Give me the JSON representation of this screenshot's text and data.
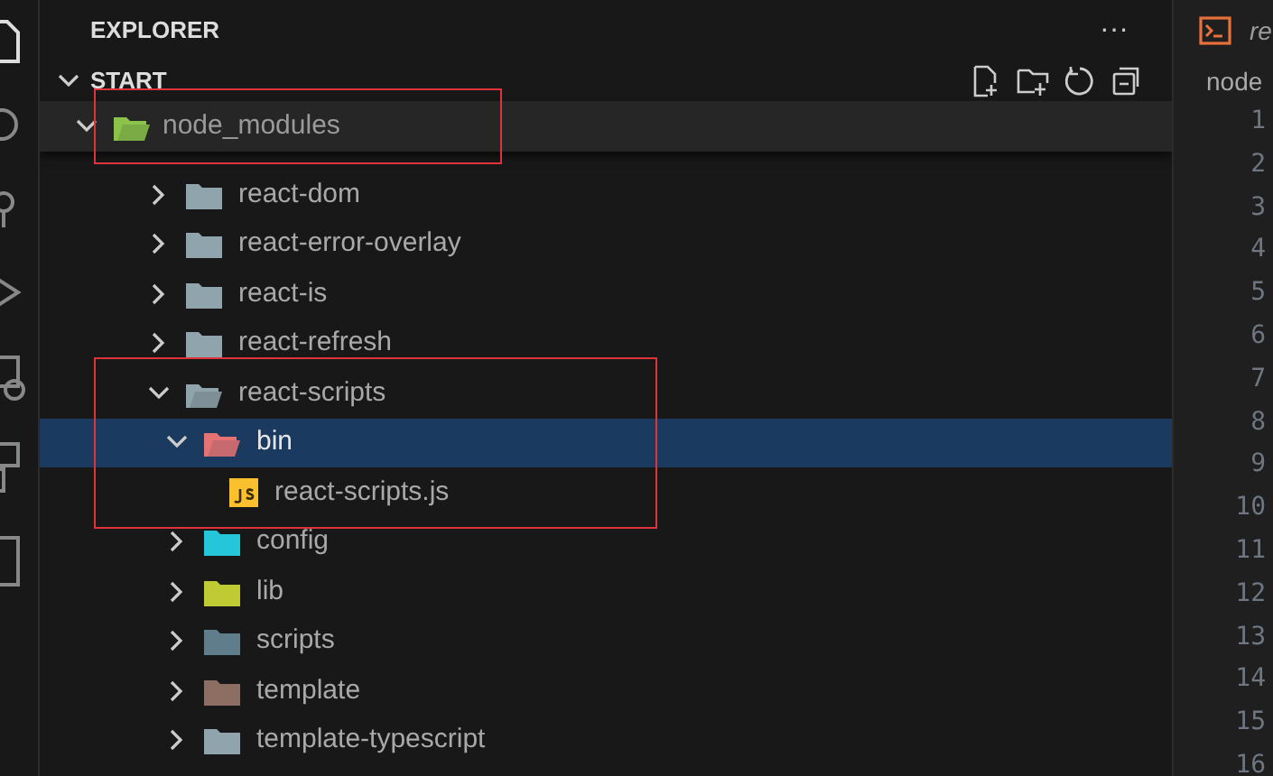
{
  "sidebar": {
    "title": "EXPLORER",
    "more": "···",
    "section": {
      "label": "START",
      "expanded": true
    },
    "sticky_header": {
      "label": "node_modules",
      "expanded": true,
      "color": "#8bc34a",
      "framed": true
    },
    "rows": [
      {
        "label": "react-dom",
        "kind": "folder",
        "expanded": false,
        "selected": false,
        "framed": false,
        "color": "#90a4ae"
      },
      {
        "label": "react-error-overlay",
        "kind": "folder",
        "expanded": false,
        "selected": false,
        "framed": false,
        "color": "#90a4ae"
      },
      {
        "label": "react-is",
        "kind": "folder",
        "expanded": false,
        "selected": false,
        "framed": false,
        "color": "#90a4ae"
      },
      {
        "label": "react-refresh",
        "kind": "folder",
        "expanded": false,
        "selected": false,
        "framed": false,
        "color": "#90a4ae"
      },
      {
        "label": "react-scripts",
        "kind": "folder",
        "expanded": true,
        "selected": false,
        "framed": true,
        "color": "#90a4ae",
        "children": [
          {
            "label": "bin",
            "kind": "folder",
            "expanded": true,
            "selected": true,
            "framed": true,
            "color": "#e57373",
            "children": [
              {
                "label": "react-scripts.js",
                "kind": "file",
                "selected": false,
                "framed": true,
                "color": "#fbc02d"
              }
            ]
          },
          {
            "label": "config",
            "kind": "folder",
            "expanded": false,
            "selected": false,
            "framed": false,
            "color": "#26c6da"
          },
          {
            "label": "lib",
            "kind": "folder",
            "expanded": false,
            "selected": false,
            "framed": false,
            "color": "#c0ca33"
          },
          {
            "label": "scripts",
            "kind": "folder",
            "expanded": false,
            "selected": false,
            "framed": false,
            "color": "#607d8b"
          },
          {
            "label": "template",
            "kind": "folder",
            "expanded": false,
            "selected": false,
            "framed": false,
            "color": "#8d6e63"
          },
          {
            "label": "template-typescript",
            "kind": "folder",
            "expanded": false,
            "selected": false,
            "framed": false,
            "color": "#90a4ae"
          }
        ]
      }
    ]
  },
  "editor": {
    "tab": "re",
    "breadcrumb": "node",
    "line_numbers": [
      "1",
      "2",
      "3",
      "4",
      "5",
      "6",
      "7",
      "8",
      "9",
      "10",
      "11",
      "12",
      "13",
      "14",
      "15",
      "16"
    ]
  }
}
